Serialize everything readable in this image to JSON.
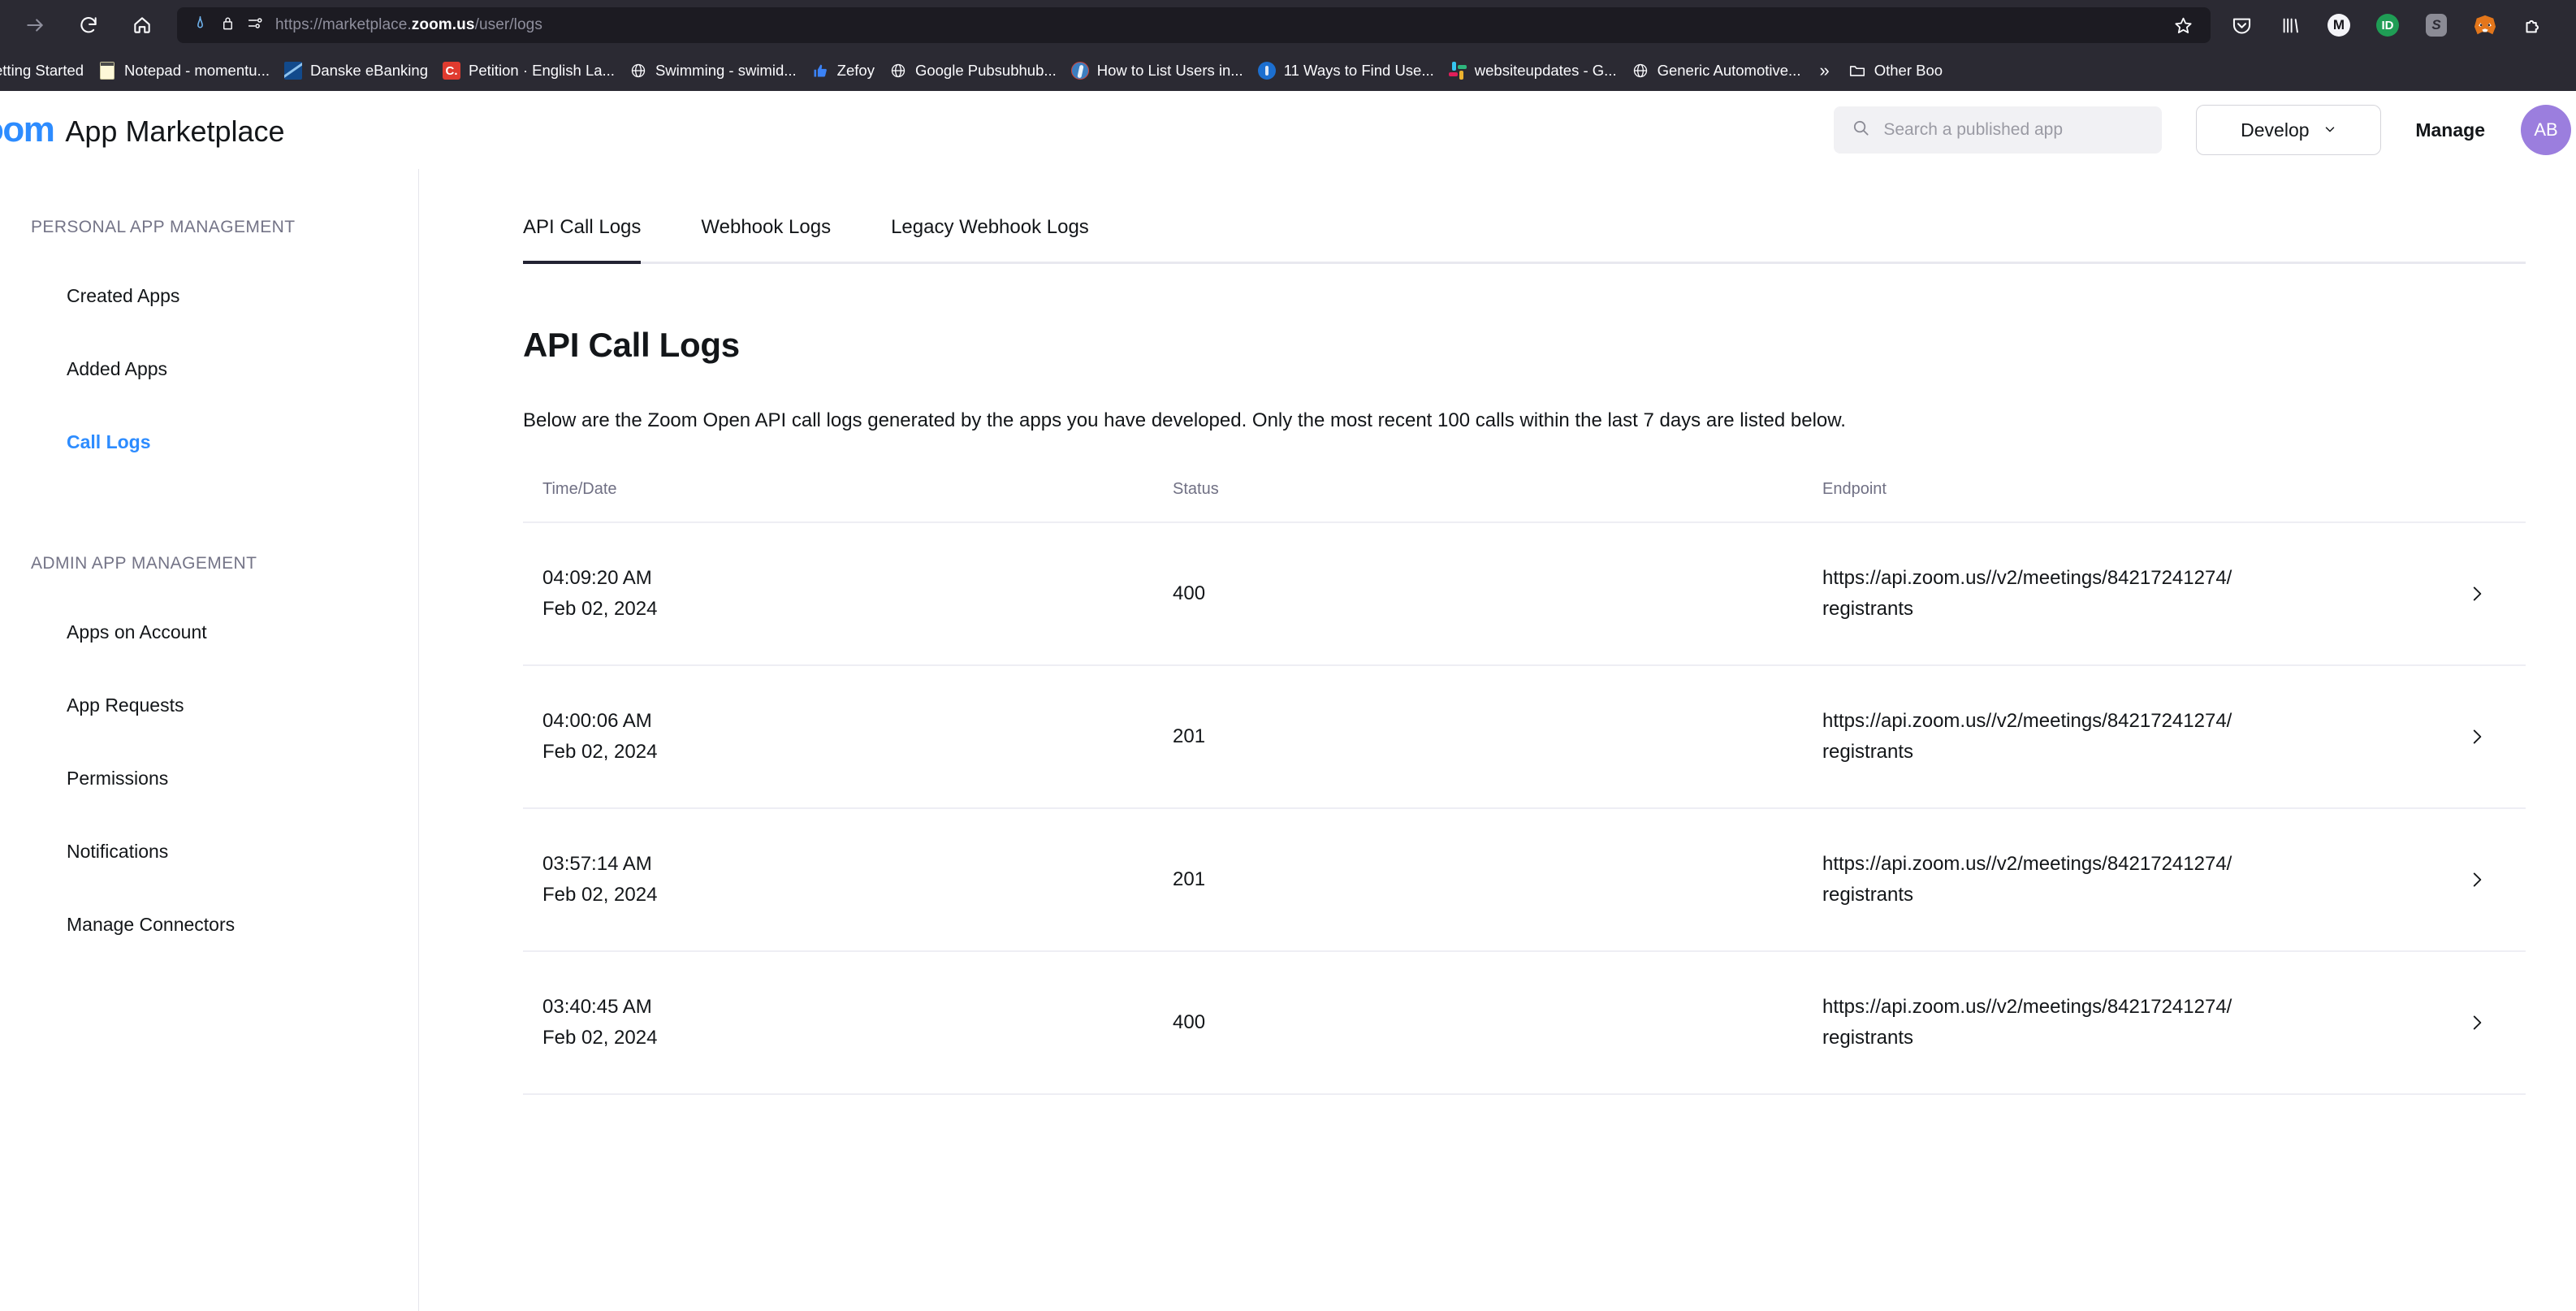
{
  "browser": {
    "nav": {
      "forward_icon": "arrow-right-icon",
      "reload_icon": "reload-icon",
      "home_icon": "home-icon"
    },
    "url": {
      "prefix": "https://marketplace.",
      "domain": "zoom.us",
      "suffix": "/user/logs",
      "full": "https://marketplace.zoom.us/user/logs",
      "shield_icon": "shield-icon",
      "lock_icon": "lock-icon",
      "permissions_icon": "site-permissions-icon",
      "bookmark_icon": "star-icon"
    },
    "extensions": [
      {
        "name": "pocket-icon",
        "label": "Pocket"
      },
      {
        "name": "library-icon",
        "label": "Library"
      },
      {
        "name": "mendeley-icon",
        "label": "M"
      },
      {
        "name": "pushbullet-icon",
        "label": "ID"
      },
      {
        "name": "surfshark-icon",
        "label": "S"
      },
      {
        "name": "metamask-icon",
        "label": "MetaMask"
      },
      {
        "name": "extensions-puzzle-icon",
        "label": "Extensions"
      }
    ],
    "bookmarks": [
      {
        "label": "etting Started",
        "icon": "generic-globe-icon"
      },
      {
        "label": "Notepad - momentu...",
        "icon": "notepad-icon"
      },
      {
        "label": "Danske eBanking",
        "icon": "danske-bank-icon"
      },
      {
        "label": "Petition · English La...",
        "icon": "change-org-icon"
      },
      {
        "label": "Swimming - swimid...",
        "icon": "globe-icon"
      },
      {
        "label": "Zefoy",
        "icon": "thumbs-up-icon"
      },
      {
        "label": "Google Pubsubhub...",
        "icon": "globe-icon"
      },
      {
        "label": "How to List Users in...",
        "icon": "article-icon"
      },
      {
        "label": "11 Ways to Find Use...",
        "icon": "blue-circle-icon"
      },
      {
        "label": "websiteupdates - G...",
        "icon": "slack-icon"
      },
      {
        "label": "Generic Automotive...",
        "icon": "globe-icon"
      }
    ],
    "overflow_label": "»",
    "other_bookmarks": {
      "label": "Other Boo",
      "icon": "folder-icon"
    }
  },
  "header": {
    "logo_text": "oom",
    "title": "App Marketplace",
    "search": {
      "placeholder": "Search a published app",
      "value": "",
      "icon": "search-icon"
    },
    "develop": {
      "label": "Develop",
      "icon": "chevron-down-icon"
    },
    "manage": {
      "label": "Manage"
    },
    "avatar": {
      "initials": "AB",
      "color": "#9b7ede"
    }
  },
  "sidebar": {
    "sections": [
      {
        "title": "PERSONAL APP MANAGEMENT",
        "items": [
          {
            "label": "Created Apps",
            "active": false
          },
          {
            "label": "Added Apps",
            "active": false
          },
          {
            "label": "Call Logs",
            "active": true
          }
        ]
      },
      {
        "title": "ADMIN APP MANAGEMENT",
        "items": [
          {
            "label": "Apps on Account",
            "active": false
          },
          {
            "label": "App Requests",
            "active": false
          },
          {
            "label": "Permissions",
            "active": false
          },
          {
            "label": "Notifications",
            "active": false
          },
          {
            "label": "Manage Connectors",
            "active": false
          }
        ]
      }
    ]
  },
  "main": {
    "tabs": [
      {
        "label": "API Call Logs",
        "active": true
      },
      {
        "label": "Webhook Logs",
        "active": false
      },
      {
        "label": "Legacy Webhook Logs",
        "active": false
      }
    ],
    "page_title": "API Call Logs",
    "description": "Below are the Zoom Open API call logs generated by the apps you have developed. Only the most recent 100 calls within the last 7 days are listed below.",
    "table": {
      "columns": [
        "Time/Date",
        "Status",
        "Endpoint"
      ],
      "rows": [
        {
          "time": "04:09:20 AM",
          "date": "Feb 02, 2024",
          "status": "400",
          "endpoint_line1": "https://api.zoom.us//v2/meetings/84217241274/",
          "endpoint_line2": "registrants",
          "chevron": "chevron-right-icon"
        },
        {
          "time": "04:00:06 AM",
          "date": "Feb 02, 2024",
          "status": "201",
          "endpoint_line1": "https://api.zoom.us//v2/meetings/84217241274/",
          "endpoint_line2": "registrants",
          "chevron": "chevron-right-icon"
        },
        {
          "time": "03:57:14 AM",
          "date": "Feb 02, 2024",
          "status": "201",
          "endpoint_line1": "https://api.zoom.us//v2/meetings/84217241274/",
          "endpoint_line2": "registrants",
          "chevron": "chevron-right-icon"
        },
        {
          "time": "03:40:45 AM",
          "date": "Feb 02, 2024",
          "status": "400",
          "endpoint_line1": "https://api.zoom.us//v2/meetings/84217241274/",
          "endpoint_line2": "registrants",
          "chevron": "chevron-right-icon"
        }
      ]
    }
  },
  "colors": {
    "chrome_bg": "#2b2a33",
    "urlbar_bg": "#1c1b22",
    "zoom_blue": "#2d8cff",
    "text_dark": "#131619",
    "muted": "#747487",
    "avatar_purple": "#9b7ede"
  }
}
